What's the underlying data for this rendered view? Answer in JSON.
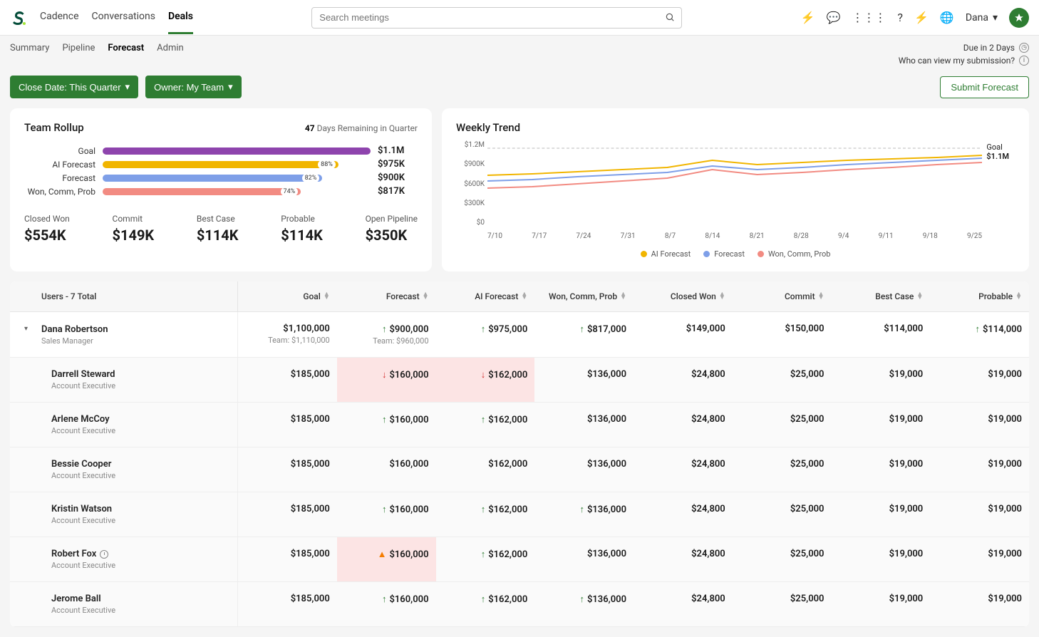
{
  "nav": {
    "items": [
      "Cadence",
      "Conversations",
      "Deals"
    ],
    "active": 2
  },
  "search": {
    "placeholder": "Search meetings"
  },
  "user": {
    "name": "Dana"
  },
  "subnav": {
    "items": [
      "Summary",
      "Pipeline",
      "Forecast",
      "Admin"
    ],
    "active": 2
  },
  "due": {
    "text": "Due in 2 Days",
    "who": "Who can view my submission?"
  },
  "filters": {
    "close_date": "Close Date: This Quarter",
    "owner": "Owner: My Team",
    "submit": "Submit Forecast"
  },
  "rollup": {
    "title": "Team Rollup",
    "remaining_num": "47",
    "remaining_text": "Days Remaining in Quarter",
    "bars": [
      {
        "label": "Goal",
        "value": "$1.1M",
        "color": "#8e44ad",
        "pct": 100,
        "badge": ""
      },
      {
        "label": "AI Forecast",
        "value": "$975K",
        "color": "#f1b500",
        "pct": 88,
        "badge": "88%"
      },
      {
        "label": "Forecast",
        "value": "$900K",
        "color": "#7e9fe8",
        "pct": 82,
        "badge": "82%"
      },
      {
        "label": "Won, Comm, Prob",
        "value": "$817K",
        "color": "#f28b82",
        "pct": 74,
        "badge": "74%"
      }
    ],
    "stats": [
      {
        "label": "Closed Won",
        "value": "$554K"
      },
      {
        "label": "Commit",
        "value": "$149K"
      },
      {
        "label": "Best Case",
        "value": "$114K"
      },
      {
        "label": "Probable",
        "value": "$114K"
      },
      {
        "label": "Open Pipeline",
        "value": "$350K"
      }
    ]
  },
  "trend": {
    "title": "Weekly Trend",
    "y_ticks": [
      "$1.2M",
      "$900K",
      "$600K",
      "$300K",
      "$0"
    ],
    "x_ticks": [
      "7/10",
      "7/17",
      "7/24",
      "7/31",
      "8/7",
      "8/14",
      "8/21",
      "8/28",
      "9/4",
      "9/11",
      "9/18",
      "9/25"
    ],
    "goal_label": "Goal",
    "goal_value": "$1.1M",
    "legend": [
      {
        "label": "AI Forecast",
        "color": "#f1b500"
      },
      {
        "label": "Forecast",
        "color": "#7e9fe8"
      },
      {
        "label": "Won, Comm, Prob",
        "color": "#f28b82"
      }
    ]
  },
  "chart_data": {
    "type": "line",
    "x": [
      "7/10",
      "7/17",
      "7/24",
      "7/31",
      "8/7",
      "8/14",
      "8/21",
      "8/28",
      "9/4",
      "9/11",
      "9/18",
      "9/25"
    ],
    "series": [
      {
        "name": "AI Forecast",
        "values": [
          720,
          740,
          770,
          800,
          830,
          930,
          870,
          900,
          930,
          950,
          970,
          1000
        ],
        "color": "#f1b500"
      },
      {
        "name": "Forecast",
        "values": [
          640,
          660,
          700,
          730,
          760,
          850,
          800,
          830,
          870,
          900,
          930,
          960
        ],
        "color": "#7e9fe8"
      },
      {
        "name": "Won, Comm, Prob",
        "values": [
          540,
          560,
          600,
          640,
          680,
          800,
          730,
          760,
          800,
          830,
          870,
          900
        ],
        "color": "#f28b82"
      }
    ],
    "goal_line": 1100,
    "ylim": [
      0,
      1200
    ],
    "ylabel": "",
    "xlabel": ""
  },
  "table": {
    "header_first": "Users - 7 Total",
    "columns": [
      "Goal",
      "Forecast",
      "AI Forecast",
      "Won, Comm, Prob",
      "Closed Won",
      "Commit",
      "Best Case",
      "Probable"
    ],
    "rows": [
      {
        "name": "Dana Robertson",
        "role": "Sales Manager",
        "expandable": true,
        "cells": [
          {
            "v": "$1,100,000",
            "sub": "Team: $1,110,000"
          },
          {
            "v": "$900,000",
            "sub": "Team: $960,000",
            "dir": "up"
          },
          {
            "v": "$975,000",
            "dir": "up"
          },
          {
            "v": "$817,000",
            "dir": "up"
          },
          {
            "v": "$149,000"
          },
          {
            "v": "$150,000"
          },
          {
            "v": "$114,000"
          },
          {
            "v": "$114,000",
            "dir": "up"
          }
        ]
      },
      {
        "name": "Darrell Steward",
        "role": "Account Executive",
        "child": true,
        "cells": [
          {
            "v": "$185,000"
          },
          {
            "v": "$160,000",
            "dir": "down",
            "bad": true
          },
          {
            "v": "$162,000",
            "dir": "down",
            "bad": true
          },
          {
            "v": "$136,000"
          },
          {
            "v": "$24,800"
          },
          {
            "v": "$25,000"
          },
          {
            "v": "$19,000"
          },
          {
            "v": "$19,000"
          }
        ]
      },
      {
        "name": "Arlene McCoy",
        "role": "Account Executive",
        "child": true,
        "cells": [
          {
            "v": "$185,000"
          },
          {
            "v": "$160,000",
            "dir": "up"
          },
          {
            "v": "$162,000",
            "dir": "up"
          },
          {
            "v": "$136,000"
          },
          {
            "v": "$24,800"
          },
          {
            "v": "$25,000"
          },
          {
            "v": "$19,000"
          },
          {
            "v": "$19,000"
          }
        ]
      },
      {
        "name": "Bessie Cooper",
        "role": "Account Executive",
        "child": true,
        "cells": [
          {
            "v": "$185,000"
          },
          {
            "v": "$160,000"
          },
          {
            "v": "$162,000"
          },
          {
            "v": "$136,000"
          },
          {
            "v": "$24,800"
          },
          {
            "v": "$25,000"
          },
          {
            "v": "$19,000"
          },
          {
            "v": "$19,000"
          }
        ]
      },
      {
        "name": "Kristin Watson",
        "role": "Account Executive",
        "child": true,
        "cells": [
          {
            "v": "$185,000"
          },
          {
            "v": "$160,000",
            "dir": "up"
          },
          {
            "v": "$162,000",
            "dir": "up"
          },
          {
            "v": "$136,000",
            "dir": "up"
          },
          {
            "v": "$24,800"
          },
          {
            "v": "$25,000"
          },
          {
            "v": "$19,000"
          },
          {
            "v": "$19,000"
          }
        ]
      },
      {
        "name": "Robert Fox",
        "role": "Account Executive",
        "child": true,
        "clock": true,
        "cells": [
          {
            "v": "$185,000"
          },
          {
            "v": "$160,000",
            "warn": true,
            "bad": true
          },
          {
            "v": "$162,000",
            "dir": "up"
          },
          {
            "v": "$136,000"
          },
          {
            "v": "$24,800"
          },
          {
            "v": "$25,000"
          },
          {
            "v": "$19,000"
          },
          {
            "v": "$19,000"
          }
        ]
      },
      {
        "name": "Jerome Ball",
        "role": "Account Executive",
        "child": true,
        "cells": [
          {
            "v": "$185,000"
          },
          {
            "v": "$160,000",
            "dir": "up"
          },
          {
            "v": "$162,000",
            "dir": "up"
          },
          {
            "v": "$136,000",
            "dir": "up"
          },
          {
            "v": "$24,800"
          },
          {
            "v": "$25,000"
          },
          {
            "v": "$19,000"
          },
          {
            "v": "$19,000"
          }
        ]
      }
    ]
  }
}
